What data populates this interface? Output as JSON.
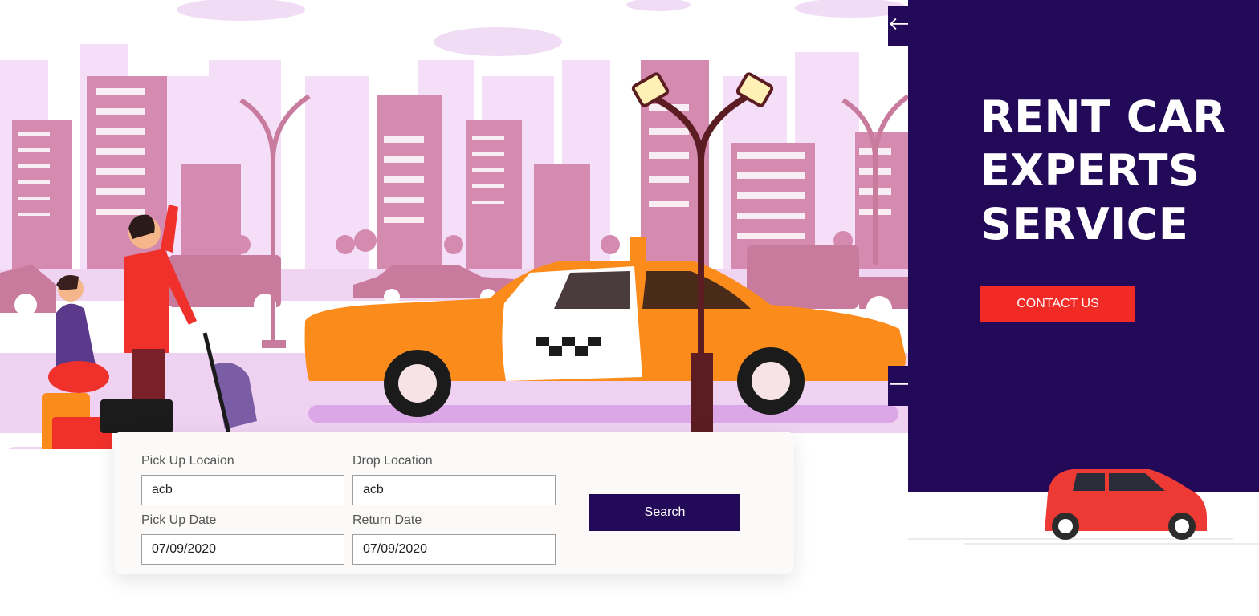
{
  "slider": {
    "prev_arrow": "🡐",
    "next_arrow": "🡒",
    "headline": "RENT CAR\nEXPERTS\nSERVICE",
    "contact_label": "CONTACT US"
  },
  "search_form": {
    "pickup_location": {
      "label": "Pick Up Locaion",
      "value": "acb"
    },
    "drop_location": {
      "label": "Drop Location",
      "value": "acb"
    },
    "pickup_date": {
      "label": "Pick Up Date",
      "value": "07/09/2020"
    },
    "return_date": {
      "label": "Return Date",
      "value": "07/09/2020"
    },
    "search_label": "Search"
  },
  "colors": {
    "brand": "#230a59",
    "accent": "#f12a26",
    "taxi": "#fb8c1b"
  },
  "icons": [
    "arrow-left-icon",
    "arrow-right-icon",
    "taxi-illustration",
    "red-car-illustration"
  ]
}
